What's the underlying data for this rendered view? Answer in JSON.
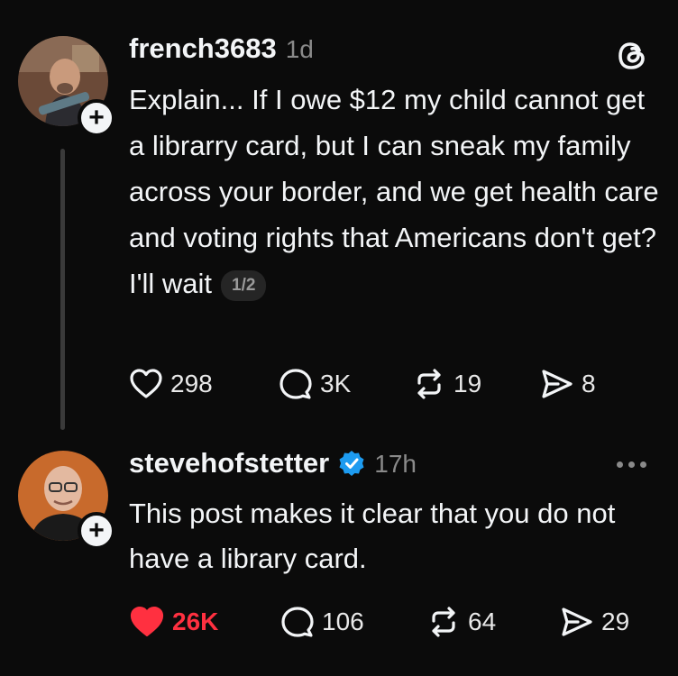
{
  "posts": [
    {
      "username": "french3683",
      "time": "1d",
      "text": "Explain... If I owe $12 my child cannot get a librarry card, but I can sneak my family across your border, and we get health care and voting rights that Americans don't get? I'll wait",
      "page_indicator": "1/2",
      "avatar_icon": "avatar-photo-man-with-guitar",
      "stats": {
        "likes": "298",
        "replies": "3K",
        "reposts": "19",
        "shares": "8"
      },
      "liked": false
    },
    {
      "username": "stevehofstetter",
      "verified": true,
      "time": "17h",
      "text": "This post makes it clear that you do not have a library card.",
      "avatar_icon": "avatar-photo-bald-man-glasses",
      "stats": {
        "likes": "26K",
        "replies": "106",
        "reposts": "64",
        "shares": "29"
      },
      "liked": true
    }
  ],
  "colors": {
    "background": "#0b0b0b",
    "text": "#f3f5f7",
    "muted": "#8a8a8a",
    "like_active": "#ff3040",
    "verified": "#1d9bf0"
  },
  "icons": {
    "app_logo": "threads-logo-icon",
    "more": "more-options-icon"
  }
}
